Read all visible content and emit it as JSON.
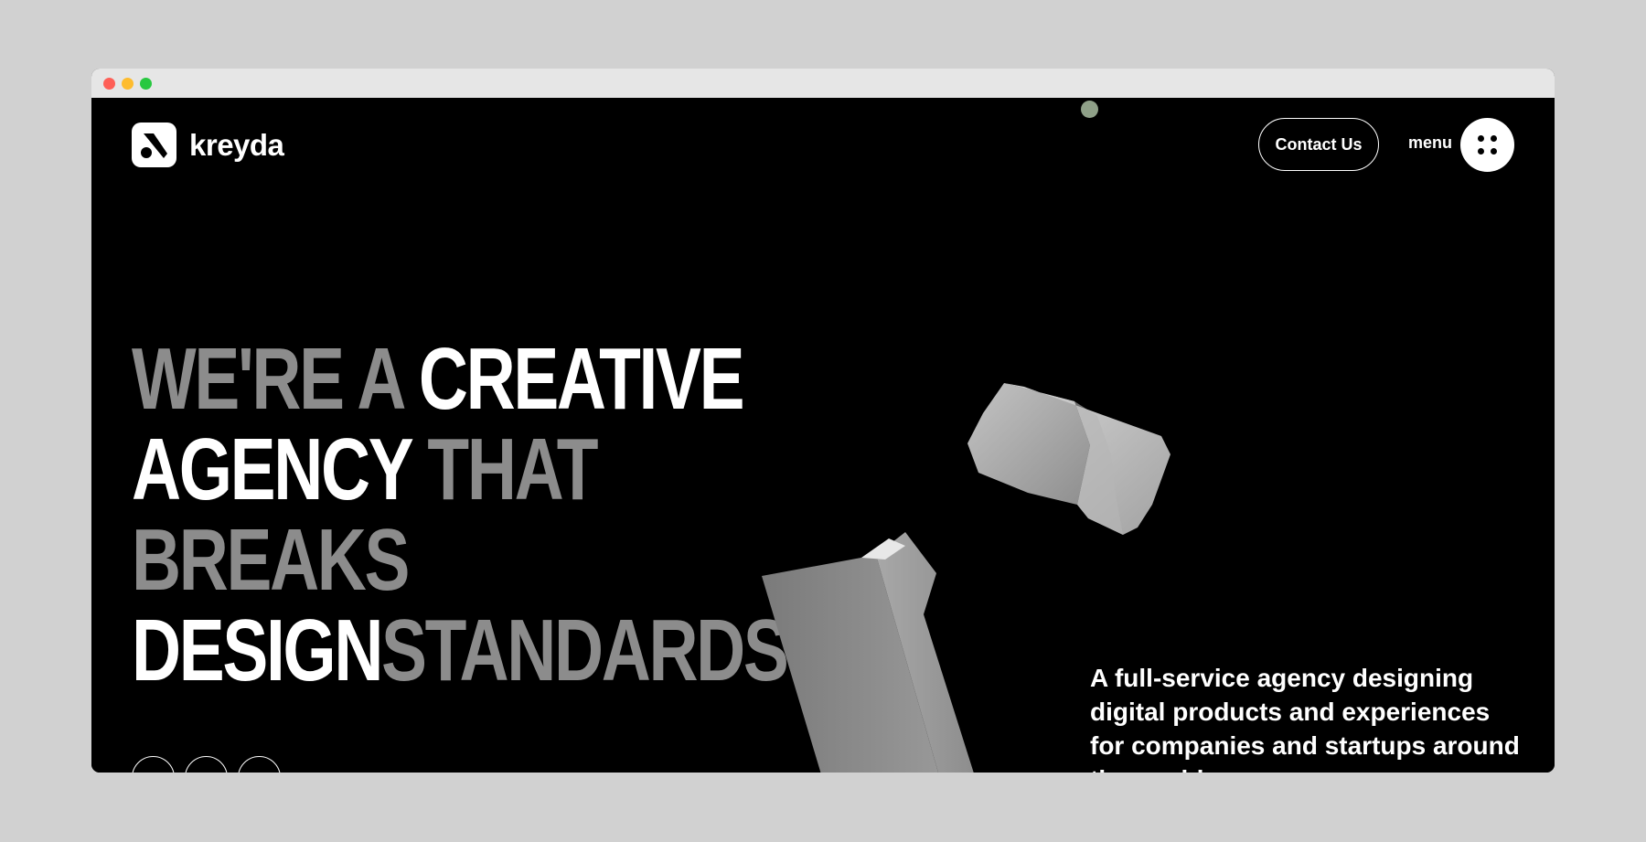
{
  "brand": {
    "name": "kreyda",
    "logo_icon": "kreyda-mark-icon"
  },
  "nav": {
    "contact_label": "Contact Us",
    "menu_label": "menu",
    "menu_icon": "four-dots-icon"
  },
  "hero": {
    "headline": {
      "line1_gray": "WE'RE A ",
      "line1_white": "CREATIVE",
      "line2_white": "AGENCY ",
      "line2_gray": "THAT",
      "line3_gray": "BREAKS",
      "line4_white": "DESIGN",
      "line4_gray": "STANDARDS"
    },
    "tagline": "A full-service agency designing digital products and experiences for companies and startups around the world"
  },
  "social_icons": [
    "circle-social-icon",
    "paper-plane-icon",
    "square-social-icon"
  ],
  "colors": {
    "background": "#000000",
    "page_frame": "#d1d1d1",
    "headline_white": "#ffffff",
    "headline_gray": "#8c8c8c",
    "cursor_dot": "#8fa088"
  }
}
